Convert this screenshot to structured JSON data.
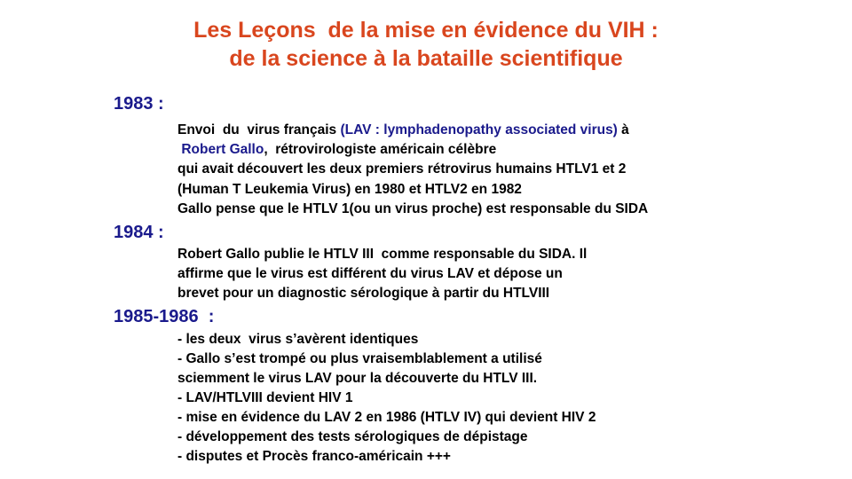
{
  "title": {
    "line1": "Les Leçons  de la mise en évidence du VIH :",
    "line2": "de la science à la bataille scientifique"
  },
  "sections": [
    {
      "year": "1983 :",
      "lines": [
        {
          "pre": "Envoi  du  virus français ",
          "accent": "(LAV : lymphadenopathy associated virus)",
          "post": " à"
        },
        {
          "pre": " ",
          "accent": "Robert Gallo",
          "post": ",  rétrovirologiste américain célèbre"
        },
        {
          "text": "qui avait découvert les deux premiers rétrovirus humains HTLV1 et 2"
        },
        {
          "text": "(Human T Leukemia Virus) en 1980 et HTLV2 en 1982"
        },
        {
          "text": "Gallo pense que le HTLV 1(ou un virus proche) est responsable du SIDA"
        }
      ]
    },
    {
      "year": "1984 :",
      "lines": [
        {
          "text": "Robert Gallo publie le HTLV III  comme responsable du SIDA. Il"
        },
        {
          "text": "affirme que le virus est différent du virus LAV et dépose un"
        },
        {
          "text": "brevet pour un diagnostic sérologique à partir du HTLVIII"
        }
      ]
    },
    {
      "year": "1985-1986  :",
      "lines": [
        {
          "text": "- les deux  virus s’avèrent identiques"
        },
        {
          "text": "- Gallo s’est trompé ou plus vraisemblablement a utilisé"
        },
        {
          "text": "sciemment le virus LAV pour la découverte du HTLV III."
        },
        {
          "text": "- LAV/HTLVIII devient HIV 1"
        },
        {
          "text": "- mise en évidence du LAV 2 en 1986 (HTLV IV) qui devient HIV 2"
        },
        {
          "text": "- développement des tests sérologiques de dépistage"
        },
        {
          "text": "- disputes et Procès franco-américain +++"
        }
      ]
    }
  ],
  "colors": {
    "title": "#d9461e",
    "year": "#1a1a8c",
    "accent": "#1a1a8c",
    "body": "#000000"
  }
}
